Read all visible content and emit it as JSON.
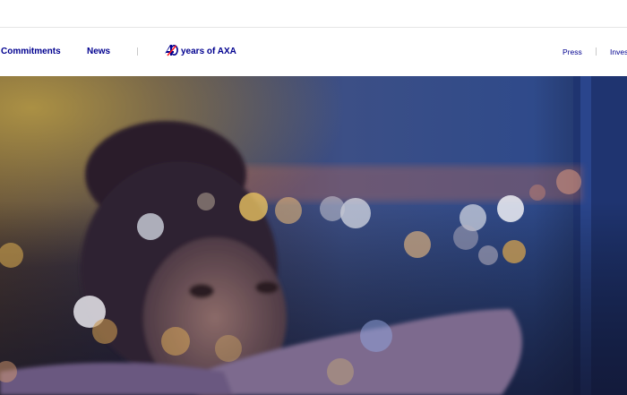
{
  "nav": {
    "items": [
      {
        "label": "Commitments"
      },
      {
        "label": "News"
      }
    ],
    "anniversary": {
      "label": "years of AXA",
      "logo_text": "40",
      "logo_colors": [
        "#00008f",
        "#ff1721"
      ]
    },
    "right_links": [
      {
        "label": "Press"
      },
      {
        "label": "Inves"
      }
    ]
  },
  "hero": {
    "image": "child-looking-through-window-at-city-lights"
  },
  "colors": {
    "brand_blue": "#00008f",
    "brand_red": "#ff1721",
    "separator": "#c9c9c9"
  }
}
